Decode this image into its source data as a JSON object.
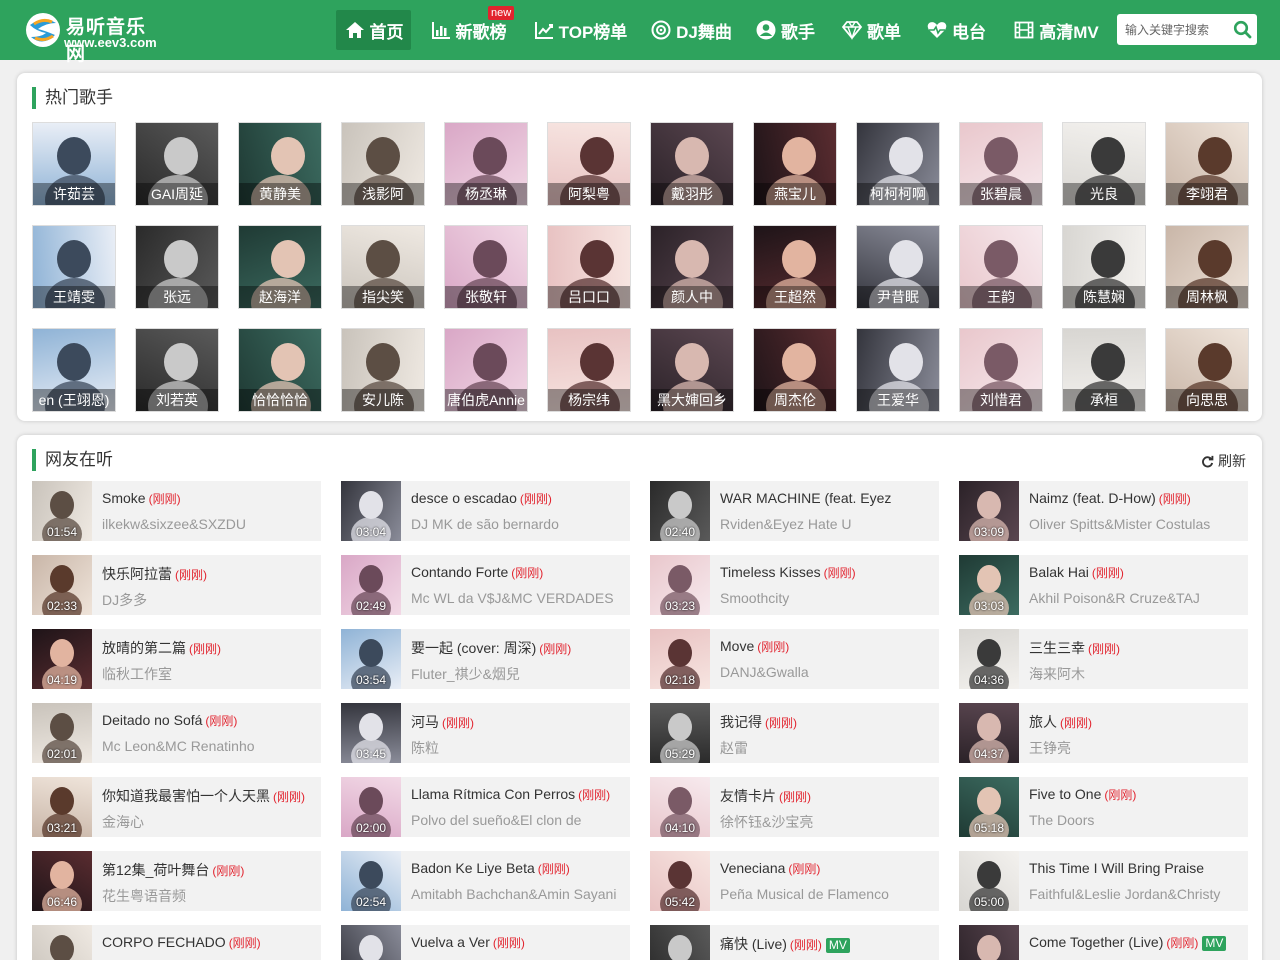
{
  "site": {
    "name": "易听音乐网",
    "url": "www.eev3.com"
  },
  "nav": [
    {
      "label": "首页",
      "icon": "home-icon",
      "active": true
    },
    {
      "label": "新歌榜",
      "icon": "bar-chart-icon",
      "badge": "new"
    },
    {
      "label": "TOP榜单",
      "icon": "line-chart-icon"
    },
    {
      "label": "DJ舞曲",
      "icon": "disc-icon"
    },
    {
      "label": "歌手",
      "icon": "user-icon"
    },
    {
      "label": "歌单",
      "icon": "diamond-icon"
    },
    {
      "label": "电台",
      "icon": "heartbeat-icon"
    },
    {
      "label": "高清MV",
      "icon": "film-icon"
    }
  ],
  "search": {
    "placeholder": "输入关键字搜索"
  },
  "hot_artists": {
    "title": "热门歌手",
    "items": [
      "许茹芸",
      "GAI周延",
      "黄静美",
      "浅影阿",
      "杨丞琳",
      "阿梨粤",
      "戴羽彤",
      "燕宝儿",
      "柯柯柯啊",
      "张碧晨",
      "光良",
      "李翊君",
      "王靖雯",
      "张远",
      "赵海洋",
      "指尖笑",
      "张敬轩",
      "吕口口",
      "颜人中",
      "王超然",
      "尹昔眠",
      "王韵",
      "陈慧娴",
      "周林枫",
      "en (王翊恩)",
      "刘若英",
      "恰恰恰恰",
      "安儿陈",
      "唐伯虎Annie",
      "杨宗纬",
      "黑大婶回乡",
      "周杰伦",
      "王爱华",
      "刘惜君",
      "承桓",
      "向思思"
    ]
  },
  "now_playing": {
    "title": "网友在听",
    "refresh_label": "刷新",
    "tag": "(刚刚)",
    "mv_label": "MV",
    "songs": [
      {
        "title": "Smoke",
        "artist": "ilkekw&sixzee&SXZDU",
        "duration": "01:54"
      },
      {
        "title": "desce o escadao",
        "artist": "DJ MK de são bernardo",
        "duration": "03:04"
      },
      {
        "title": "WAR MACHINE (feat. Eyez",
        "artist": "Rviden&Eyez Hate U",
        "duration": "02:40",
        "no_tag": true
      },
      {
        "title": "Naimz (feat. D-How)",
        "artist": "Oliver Spitts&Mister Costulas",
        "duration": "03:09"
      },
      {
        "title": "快乐阿拉蕾",
        "artist": "DJ多多",
        "duration": "02:33"
      },
      {
        "title": "Contando Forte",
        "artist": "Mc WL da V$J&MC VERDADES",
        "duration": "02:49"
      },
      {
        "title": "Timeless Kisses",
        "artist": "Smoothcity",
        "duration": "03:23"
      },
      {
        "title": "Balak Hai",
        "artist": "Akhil Poison&R Cruze&TAJ",
        "duration": "03:03"
      },
      {
        "title": "放晴的第二篇",
        "artist": "临秋工作室",
        "duration": "04:19"
      },
      {
        "title": "要一起 (cover: 周深)",
        "artist": "Fluter_祺少&烟兒",
        "duration": "03:54"
      },
      {
        "title": "Move",
        "artist": "DANJ&Gwalla",
        "duration": "02:18"
      },
      {
        "title": "三生三幸",
        "artist": "海来阿木",
        "duration": "04:36"
      },
      {
        "title": "Deitado no Sofá",
        "artist": "Mc Leon&MC Renatinho",
        "duration": "02:01"
      },
      {
        "title": "河马",
        "artist": "陈粒",
        "duration": "03:45"
      },
      {
        "title": "我记得",
        "artist": "赵雷",
        "duration": "05:29"
      },
      {
        "title": "旅人",
        "artist": "王铮亮",
        "duration": "04:37"
      },
      {
        "title": "你知道我最害怕一个人天黑",
        "artist": "金海心",
        "duration": "03:21"
      },
      {
        "title": "Llama Rítmica Con Perros",
        "artist": "Polvo del sueño&El clon de",
        "duration": "02:00"
      },
      {
        "title": "友情卡片",
        "artist": "徐怀钰&沙宝亮",
        "duration": "04:10"
      },
      {
        "title": "Five to One",
        "artist": "The Doors",
        "duration": "05:18"
      },
      {
        "title": "第12集_荷叶舞台",
        "artist": "花生粤语音频",
        "duration": "06:46"
      },
      {
        "title": "Badon Ke Liye Beta",
        "artist": "Amitabh Bachchan&Amin Sayani",
        "duration": "02:54"
      },
      {
        "title": "Veneciana",
        "artist": "Peña Musical de Flamenco",
        "duration": "05:42"
      },
      {
        "title": "This Time I Will Bring Praise",
        "artist": "Faithful&Leslie Jordan&Christy",
        "duration": "05:00",
        "no_tag": true
      },
      {
        "title": "CORPO FECHADO",
        "artist": "",
        "duration": ""
      },
      {
        "title": "Vuelva a Ver",
        "artist": "",
        "duration": ""
      },
      {
        "title": "痛快 (Live)",
        "artist": "",
        "duration": "",
        "mv": true
      },
      {
        "title": "Come Together (Live)",
        "artist": "",
        "duration": "",
        "mv": true
      }
    ]
  },
  "colors": {
    "brand": "#2ea35d",
    "brand_dark": "#22884a",
    "tag": "#e2232e"
  }
}
